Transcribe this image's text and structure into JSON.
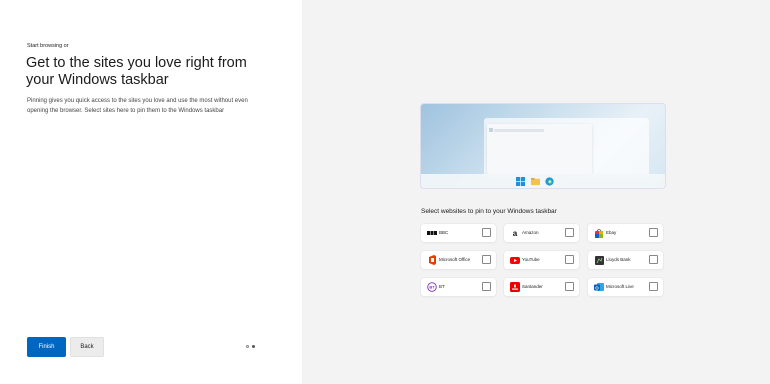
{
  "intro": {
    "eyebrow": "Start browsing or",
    "title": "Get to the sites you love right from your Windows taskbar",
    "description": "Pinning gives you quick access to the sites you love and use the most without even opening the browser. Select sites here to pin them to the Windows taskbar"
  },
  "buttons": {
    "finish": "Finish",
    "back": "Back"
  },
  "pager": {
    "current": 2,
    "total": 2
  },
  "section_title": "Select websites to pin to your Windows taskbar",
  "sites": [
    {
      "name": "BBC",
      "icon": "bbc-icon",
      "checked": false
    },
    {
      "name": "Amazon",
      "icon": "amazon-icon",
      "checked": false
    },
    {
      "name": "Ebay",
      "icon": "ebay-icon",
      "checked": false
    },
    {
      "name": "Microsoft Office",
      "icon": "office-icon",
      "checked": false
    },
    {
      "name": "YouTube",
      "icon": "youtube-icon",
      "checked": false
    },
    {
      "name": "Lloyds Bank",
      "icon": "lloyds-icon",
      "checked": false
    },
    {
      "name": "BT",
      "icon": "bt-icon",
      "checked": false
    },
    {
      "name": "Santander",
      "icon": "santander-icon",
      "checked": false
    },
    {
      "name": "Microsoft Live",
      "icon": "outlook-icon",
      "checked": false
    }
  ],
  "colors": {
    "accent": "#0067c0",
    "background": "#f3f3f3"
  }
}
